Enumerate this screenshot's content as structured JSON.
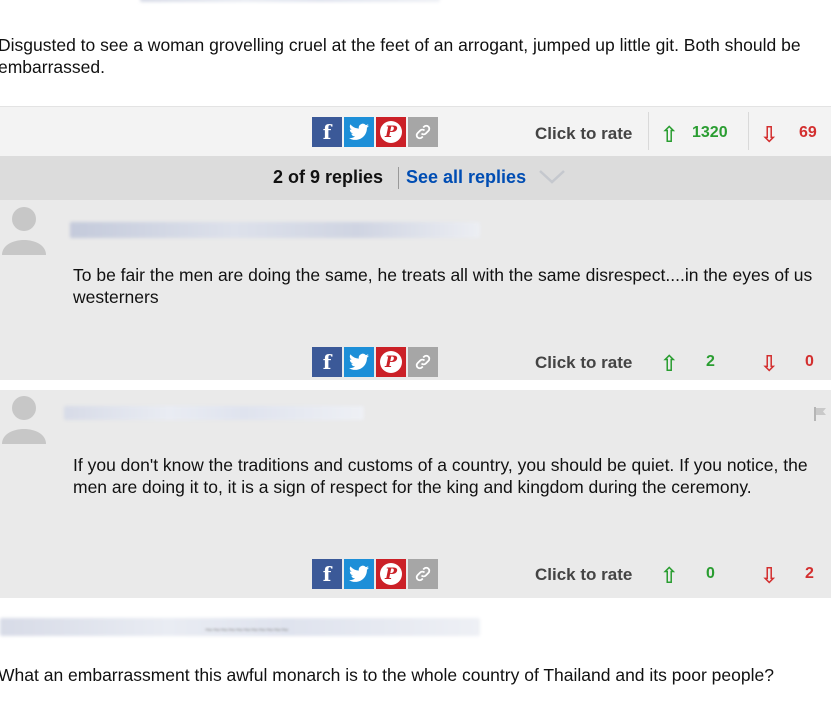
{
  "top_comment": {
    "text": "Disgusted to see a woman grovelling cruel at the feet of an arrogant, jumped up little git. Both should be embarrassed.",
    "rate_label": "Click to rate",
    "upvotes": "1320",
    "downvotes": "69"
  },
  "replies_bar": {
    "count_text": "2 of 9 replies",
    "see_all": "See all replies"
  },
  "replies": [
    {
      "text": "To be fair the men are doing the same, he treats all with the same disrespect....in the eyes of us westerners",
      "rate_label": "Click to rate",
      "upvotes": "2",
      "downvotes": "0"
    },
    {
      "text": "If you don't know the traditions and customs of a country, you should be quiet. If you notice, the men are doing it to, it is a sign of respect for the king and kingdom during the ceremony.",
      "rate_label": "Click to rate",
      "upvotes": "0",
      "downvotes": "2"
    }
  ],
  "next_comment": {
    "text": "What an embarrassment this awful monarch is to the whole country of Thailand and its poor people?"
  },
  "icons": {
    "facebook": "f",
    "pinterest": "P",
    "upvote_arrow": "⇧",
    "downvote_arrow": "⇩"
  },
  "colors": {
    "facebook": "#3b5998",
    "twitter": "#1d8fd8",
    "pinterest": "#cb2027",
    "link": "#a6a6a6",
    "upvote": "#2a9d31",
    "downvote": "#d32f2f",
    "link_blue": "#004db3"
  }
}
